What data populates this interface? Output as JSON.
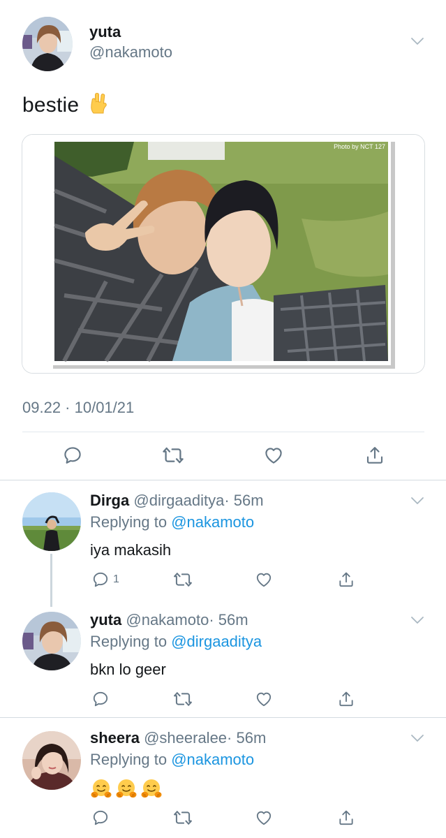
{
  "main_tweet": {
    "name": "yuta",
    "handle": "@nakamoto",
    "text": "bestie",
    "emoji": "rock-on-hand",
    "photo_credit": "Photo by NCT 127",
    "timestamp": "09.22 · 10/01/21",
    "icons": [
      "reply-icon",
      "retweet-icon",
      "like-icon",
      "share-icon"
    ]
  },
  "replies": [
    {
      "name": "Dirga",
      "handle": "@dirgaaditya",
      "time": "· 56m",
      "replying_prefix": "Replying to ",
      "replying_to": "@nakamoto",
      "text": "iya makasih",
      "reply_count": "1"
    },
    {
      "name": "yuta",
      "handle": "@nakamoto",
      "time": "· 56m",
      "replying_prefix": "Replying to ",
      "replying_to": "@dirgaaditya",
      "text": "bkn lo geer",
      "reply_count": ""
    },
    {
      "name": "sheera",
      "handle": "@sheeralee",
      "time": "· 56m",
      "replying_prefix": "Replying to ",
      "replying_to": "@nakamoto",
      "text": "",
      "emoji": [
        "hugging-face",
        "hugging-face",
        "hugging-face"
      ],
      "reply_count": ""
    }
  ],
  "colors": {
    "text": "#14171a",
    "muted": "#657786",
    "link": "#1b95e0",
    "divider": "#e1e8ed",
    "icon": "#657786"
  }
}
